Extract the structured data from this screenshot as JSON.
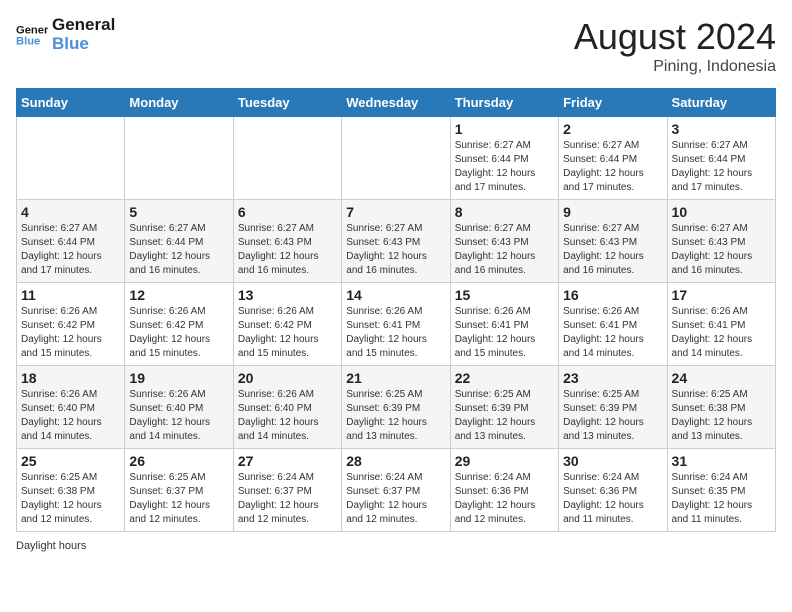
{
  "header": {
    "logo_text_general": "General",
    "logo_text_blue": "Blue",
    "month_year": "August 2024",
    "location": "Pining, Indonesia"
  },
  "calendar": {
    "weekdays": [
      "Sunday",
      "Monday",
      "Tuesday",
      "Wednesday",
      "Thursday",
      "Friday",
      "Saturday"
    ],
    "weeks": [
      [
        {
          "day": "",
          "sunrise": "",
          "sunset": "",
          "daylight": ""
        },
        {
          "day": "",
          "sunrise": "",
          "sunset": "",
          "daylight": ""
        },
        {
          "day": "",
          "sunrise": "",
          "sunset": "",
          "daylight": ""
        },
        {
          "day": "",
          "sunrise": "",
          "sunset": "",
          "daylight": ""
        },
        {
          "day": "1",
          "sunrise": "Sunrise: 6:27 AM",
          "sunset": "Sunset: 6:44 PM",
          "daylight": "Daylight: 12 hours and 17 minutes."
        },
        {
          "day": "2",
          "sunrise": "Sunrise: 6:27 AM",
          "sunset": "Sunset: 6:44 PM",
          "daylight": "Daylight: 12 hours and 17 minutes."
        },
        {
          "day": "3",
          "sunrise": "Sunrise: 6:27 AM",
          "sunset": "Sunset: 6:44 PM",
          "daylight": "Daylight: 12 hours and 17 minutes."
        }
      ],
      [
        {
          "day": "4",
          "sunrise": "Sunrise: 6:27 AM",
          "sunset": "Sunset: 6:44 PM",
          "daylight": "Daylight: 12 hours and 17 minutes."
        },
        {
          "day": "5",
          "sunrise": "Sunrise: 6:27 AM",
          "sunset": "Sunset: 6:44 PM",
          "daylight": "Daylight: 12 hours and 16 minutes."
        },
        {
          "day": "6",
          "sunrise": "Sunrise: 6:27 AM",
          "sunset": "Sunset: 6:43 PM",
          "daylight": "Daylight: 12 hours and 16 minutes."
        },
        {
          "day": "7",
          "sunrise": "Sunrise: 6:27 AM",
          "sunset": "Sunset: 6:43 PM",
          "daylight": "Daylight: 12 hours and 16 minutes."
        },
        {
          "day": "8",
          "sunrise": "Sunrise: 6:27 AM",
          "sunset": "Sunset: 6:43 PM",
          "daylight": "Daylight: 12 hours and 16 minutes."
        },
        {
          "day": "9",
          "sunrise": "Sunrise: 6:27 AM",
          "sunset": "Sunset: 6:43 PM",
          "daylight": "Daylight: 12 hours and 16 minutes."
        },
        {
          "day": "10",
          "sunrise": "Sunrise: 6:27 AM",
          "sunset": "Sunset: 6:43 PM",
          "daylight": "Daylight: 12 hours and 16 minutes."
        }
      ],
      [
        {
          "day": "11",
          "sunrise": "Sunrise: 6:26 AM",
          "sunset": "Sunset: 6:42 PM",
          "daylight": "Daylight: 12 hours and 15 minutes."
        },
        {
          "day": "12",
          "sunrise": "Sunrise: 6:26 AM",
          "sunset": "Sunset: 6:42 PM",
          "daylight": "Daylight: 12 hours and 15 minutes."
        },
        {
          "day": "13",
          "sunrise": "Sunrise: 6:26 AM",
          "sunset": "Sunset: 6:42 PM",
          "daylight": "Daylight: 12 hours and 15 minutes."
        },
        {
          "day": "14",
          "sunrise": "Sunrise: 6:26 AM",
          "sunset": "Sunset: 6:41 PM",
          "daylight": "Daylight: 12 hours and 15 minutes."
        },
        {
          "day": "15",
          "sunrise": "Sunrise: 6:26 AM",
          "sunset": "Sunset: 6:41 PM",
          "daylight": "Daylight: 12 hours and 15 minutes."
        },
        {
          "day": "16",
          "sunrise": "Sunrise: 6:26 AM",
          "sunset": "Sunset: 6:41 PM",
          "daylight": "Daylight: 12 hours and 14 minutes."
        },
        {
          "day": "17",
          "sunrise": "Sunrise: 6:26 AM",
          "sunset": "Sunset: 6:41 PM",
          "daylight": "Daylight: 12 hours and 14 minutes."
        }
      ],
      [
        {
          "day": "18",
          "sunrise": "Sunrise: 6:26 AM",
          "sunset": "Sunset: 6:40 PM",
          "daylight": "Daylight: 12 hours and 14 minutes."
        },
        {
          "day": "19",
          "sunrise": "Sunrise: 6:26 AM",
          "sunset": "Sunset: 6:40 PM",
          "daylight": "Daylight: 12 hours and 14 minutes."
        },
        {
          "day": "20",
          "sunrise": "Sunrise: 6:26 AM",
          "sunset": "Sunset: 6:40 PM",
          "daylight": "Daylight: 12 hours and 14 minutes."
        },
        {
          "day": "21",
          "sunrise": "Sunrise: 6:25 AM",
          "sunset": "Sunset: 6:39 PM",
          "daylight": "Daylight: 12 hours and 13 minutes."
        },
        {
          "day": "22",
          "sunrise": "Sunrise: 6:25 AM",
          "sunset": "Sunset: 6:39 PM",
          "daylight": "Daylight: 12 hours and 13 minutes."
        },
        {
          "day": "23",
          "sunrise": "Sunrise: 6:25 AM",
          "sunset": "Sunset: 6:39 PM",
          "daylight": "Daylight: 12 hours and 13 minutes."
        },
        {
          "day": "24",
          "sunrise": "Sunrise: 6:25 AM",
          "sunset": "Sunset: 6:38 PM",
          "daylight": "Daylight: 12 hours and 13 minutes."
        }
      ],
      [
        {
          "day": "25",
          "sunrise": "Sunrise: 6:25 AM",
          "sunset": "Sunset: 6:38 PM",
          "daylight": "Daylight: 12 hours and 12 minutes."
        },
        {
          "day": "26",
          "sunrise": "Sunrise: 6:25 AM",
          "sunset": "Sunset: 6:37 PM",
          "daylight": "Daylight: 12 hours and 12 minutes."
        },
        {
          "day": "27",
          "sunrise": "Sunrise: 6:24 AM",
          "sunset": "Sunset: 6:37 PM",
          "daylight": "Daylight: 12 hours and 12 minutes."
        },
        {
          "day": "28",
          "sunrise": "Sunrise: 6:24 AM",
          "sunset": "Sunset: 6:37 PM",
          "daylight": "Daylight: 12 hours and 12 minutes."
        },
        {
          "day": "29",
          "sunrise": "Sunrise: 6:24 AM",
          "sunset": "Sunset: 6:36 PM",
          "daylight": "Daylight: 12 hours and 12 minutes."
        },
        {
          "day": "30",
          "sunrise": "Sunrise: 6:24 AM",
          "sunset": "Sunset: 6:36 PM",
          "daylight": "Daylight: 12 hours and 11 minutes."
        },
        {
          "day": "31",
          "sunrise": "Sunrise: 6:24 AM",
          "sunset": "Sunset: 6:35 PM",
          "daylight": "Daylight: 12 hours and 11 minutes."
        }
      ]
    ]
  },
  "footer": {
    "note": "Daylight hours"
  }
}
